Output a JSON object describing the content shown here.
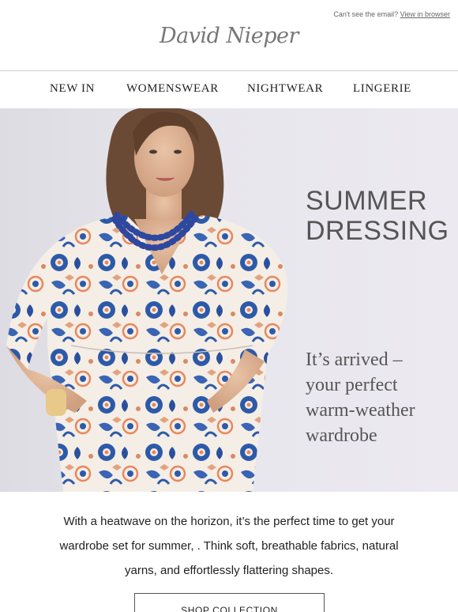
{
  "header": {
    "preheader_text": "Can't see the email?",
    "view_in_browser": "View in browser",
    "logo_text": "David Nieper"
  },
  "nav": {
    "items": [
      {
        "label": "NEW IN"
      },
      {
        "label": "WOMENSWEAR"
      },
      {
        "label": "NIGHTWEAR"
      },
      {
        "label": "LINGERIE"
      }
    ]
  },
  "hero": {
    "title_line1": "SUMMER",
    "title_line2": "DRESSING",
    "subtitle_line1": "It’s arrived –",
    "subtitle_line2": "your perfect",
    "subtitle_line3": "warm-weather",
    "subtitle_line4": "wardrobe",
    "image_alt": "Model wearing blue and white floral print dress with blue beaded necklace"
  },
  "body": {
    "line1": "With a heatwave on the horizon, it’s the perfect time to get your",
    "line2": "wardrobe set for summer, . Think soft, breathable fabrics, natural",
    "line3": "yarns, and effortlessly flattering shapes."
  },
  "cta": {
    "label": "SHOP COLLECTION"
  },
  "colors": {
    "print_blue": "#2d5aa8",
    "hero_bg": "#e6e5eb",
    "text_grey": "#555555"
  }
}
